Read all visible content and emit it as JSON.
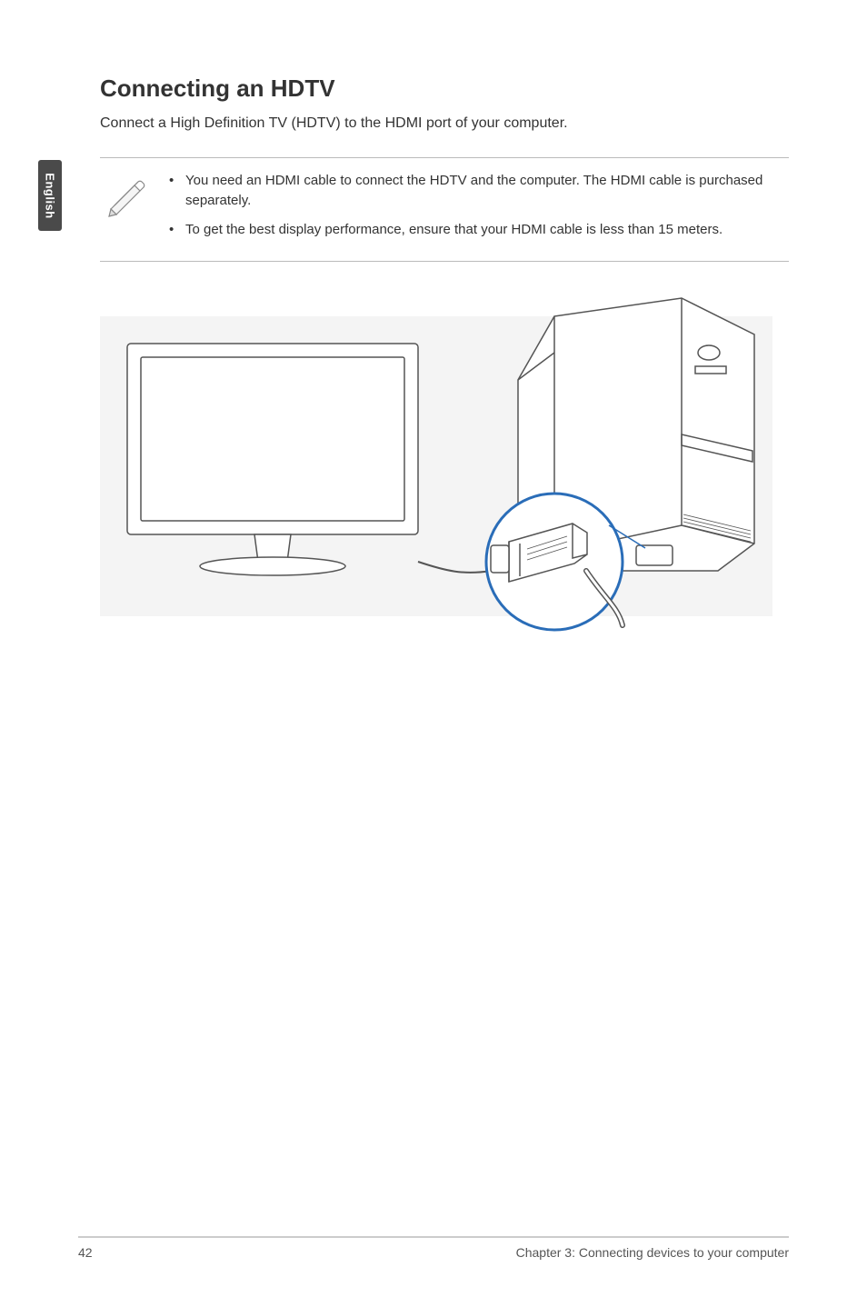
{
  "sidebar": {
    "language": "English"
  },
  "heading": "Connecting an HDTV",
  "intro": "Connect a High Definition TV (HDTV) to the HDMI port of your computer.",
  "notes": {
    "item1": "You need an HDMI cable to connect the HDTV and the computer. The HDMI cable is purchased separately.",
    "item2": "To get the best display performance, ensure that your HDMI cable is less than 15 meters."
  },
  "footer": {
    "page_number": "42",
    "chapter": "Chapter 3: Connecting devices to your computer"
  }
}
